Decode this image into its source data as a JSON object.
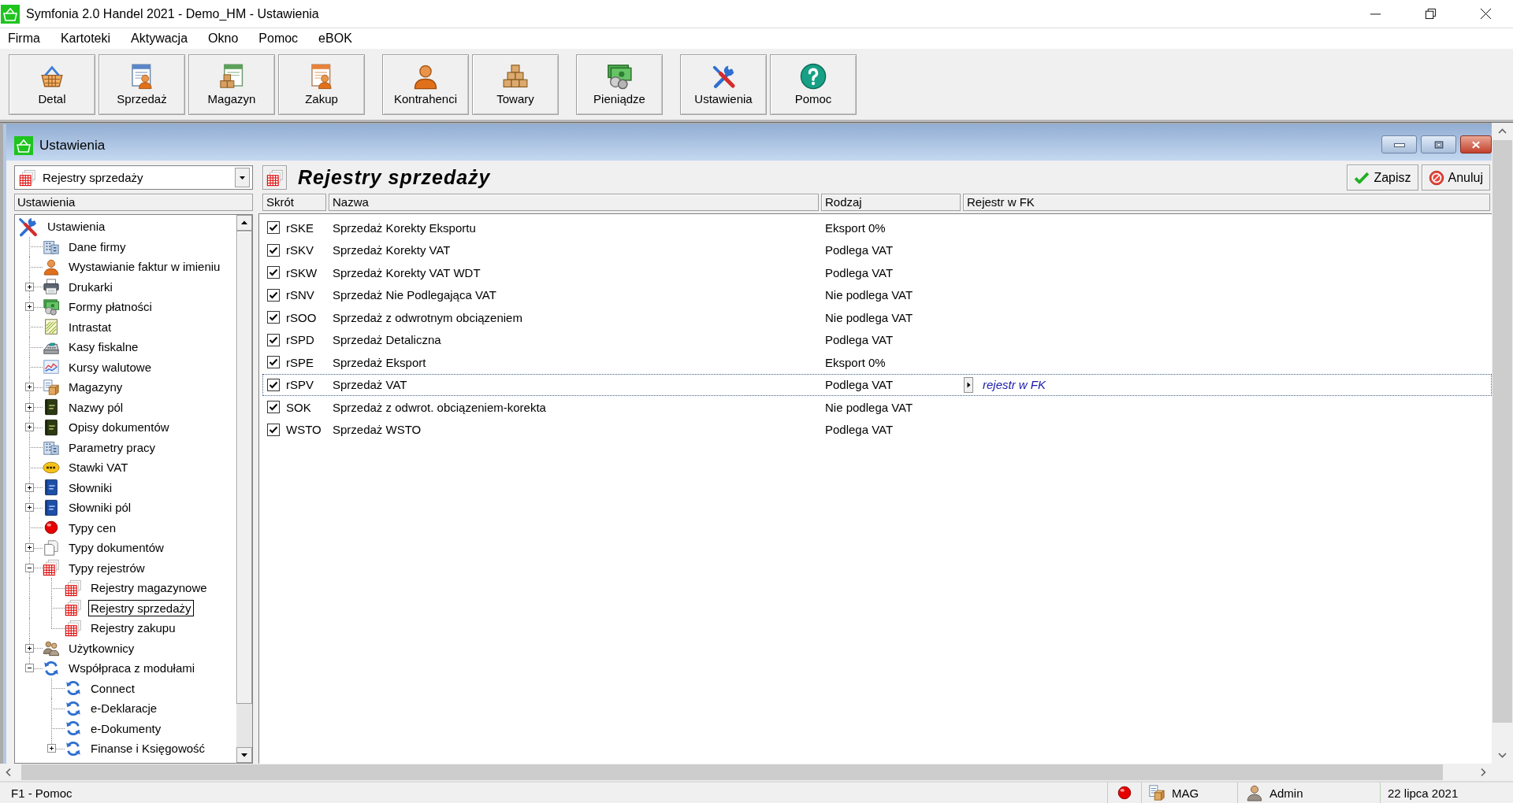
{
  "window": {
    "title": "Symfonia 2.0 Handel 2021 - Demo_HM - Ustawienia"
  },
  "menu": [
    "Firma",
    "Kartoteki",
    "Aktywacja",
    "Okno",
    "Pomoc",
    "eBOK"
  ],
  "toolbar": {
    "groups": [
      {
        "buttons": [
          {
            "label": "Detal",
            "kind": "basket"
          },
          {
            "label": "Sprzedaż",
            "kind": "sales"
          },
          {
            "label": "Magazyn",
            "kind": "warehouse"
          },
          {
            "label": "Zakup",
            "kind": "purchase"
          }
        ]
      },
      {
        "buttons": [
          {
            "label": "Kontrahenci",
            "kind": "person"
          },
          {
            "label": "Towary",
            "kind": "boxes"
          }
        ]
      },
      {
        "buttons": [
          {
            "label": "Pieniądze",
            "kind": "money"
          }
        ]
      },
      {
        "buttons": [
          {
            "label": "Ustawienia",
            "kind": "tools"
          },
          {
            "label": "Pomoc",
            "kind": "help"
          }
        ]
      }
    ]
  },
  "child_window": {
    "title": "Ustawienia"
  },
  "section_picker": {
    "value": "Rejestry sprzedaży"
  },
  "settings_tree": {
    "header": "Ustawienia",
    "nodes": [
      {
        "label": "Ustawienia",
        "kind": "tools",
        "selected": false,
        "children": [
          {
            "label": "Dane firmy",
            "kind": "building",
            "selected": false
          },
          {
            "label": "Wystawianie faktur w imieniu",
            "kind": "person",
            "selected": false
          },
          {
            "label": "Drukarki",
            "kind": "printer",
            "expanded": false,
            "selected": false
          },
          {
            "label": "Formy płatności",
            "kind": "money",
            "expanded": false,
            "selected": false
          },
          {
            "label": "Intrastat",
            "kind": "notepad",
            "selected": false
          },
          {
            "label": "Kasy fiskalne",
            "kind": "register",
            "selected": false
          },
          {
            "label": "Kursy walutowe",
            "kind": "chart",
            "selected": false
          },
          {
            "label": "Magazyny",
            "kind": "store",
            "expanded": false,
            "selected": false
          },
          {
            "label": "Nazwy pól",
            "kind": "book-dark",
            "expanded": false,
            "selected": false
          },
          {
            "label": "Opisy dokumentów",
            "kind": "book-dark",
            "expanded": false,
            "selected": false
          },
          {
            "label": "Parametry pracy",
            "kind": "building",
            "selected": false
          },
          {
            "label": "Stawki VAT",
            "kind": "vat",
            "selected": false
          },
          {
            "label": "Słowniki",
            "kind": "book-blue",
            "expanded": false,
            "selected": false
          },
          {
            "label": "Słowniki pól",
            "kind": "book-blue",
            "expanded": false,
            "selected": false
          },
          {
            "label": "Typy cen",
            "kind": "ball",
            "selected": false
          },
          {
            "label": "Typy dokumentów",
            "kind": "documents",
            "expanded": false,
            "selected": false
          },
          {
            "label": "Typy rejestrów",
            "kind": "grid",
            "expanded": true,
            "selected": false,
            "children": [
              {
                "label": "Rejestry magazynowe",
                "kind": "grid",
                "selected": false
              },
              {
                "label": "Rejestry sprzedaży",
                "kind": "grid",
                "selected": true
              },
              {
                "label": "Rejestry zakupu",
                "kind": "grid",
                "selected": false
              }
            ]
          },
          {
            "label": "Użytkownicy",
            "kind": "users",
            "expanded": false,
            "selected": false
          },
          {
            "label": "Współpraca z modułami",
            "kind": "sync",
            "expanded": true,
            "selected": false,
            "children": [
              {
                "label": "Connect",
                "kind": "sync",
                "selected": false
              },
              {
                "label": "e-Deklaracje",
                "kind": "sync",
                "selected": false
              },
              {
                "label": "e-Dokumenty",
                "kind": "sync",
                "selected": false
              },
              {
                "label": "Finanse i Księgowość",
                "kind": "sync",
                "expanded": false,
                "selected": false
              }
            ]
          }
        ]
      }
    ]
  },
  "panel": {
    "title": "Rejestry sprzedaży",
    "buttons": [
      {
        "label": "Zapisz",
        "kind": "save"
      },
      {
        "label": "Anuluj",
        "kind": "cancel"
      }
    ]
  },
  "table": {
    "columns": [
      "Skrót",
      "Nazwa",
      "Rodzaj",
      "Rejestr w FK"
    ],
    "rows": [
      {
        "checked": true,
        "code": "rSKE",
        "name": "Sprzedaż Korekty Eksportu",
        "type": "Eksport 0%",
        "selected": false
      },
      {
        "checked": true,
        "code": "rSKV",
        "name": "Sprzedaż Korekty VAT",
        "type": "Podlega VAT",
        "selected": false
      },
      {
        "checked": true,
        "code": "rSKW",
        "name": "Sprzedaż Korekty VAT WDT",
        "type": "Podlega VAT",
        "selected": false
      },
      {
        "checked": true,
        "code": "rSNV",
        "name": "Sprzedaż Nie Podlegająca VAT",
        "type": "Nie podlega VAT",
        "selected": false
      },
      {
        "checked": true,
        "code": "rSOO",
        "name": "Sprzedaż z odwrotnym obciązeniem",
        "type": "Nie podlega VAT",
        "selected": false
      },
      {
        "checked": true,
        "code": "rSPD",
        "name": "Sprzedaż Detaliczna",
        "type": "Podlega VAT",
        "selected": false
      },
      {
        "checked": true,
        "code": "rSPE",
        "name": "Sprzedaż Eksport",
        "type": "Eksport 0%",
        "selected": false
      },
      {
        "checked": true,
        "code": "rSPV",
        "name": "Sprzedaż VAT",
        "type": "Podlega VAT",
        "selected": true,
        "fk_register": "rejestr w FK"
      },
      {
        "checked": true,
        "code": "SOK",
        "name": "Sprzedaż z odwrot. obciązeniem-korekta",
        "type": "Nie podlega VAT",
        "selected": false
      },
      {
        "checked": true,
        "code": "WSTO",
        "name": "Sprzedaż WSTO",
        "type": "Podlega VAT",
        "selected": false
      }
    ]
  },
  "status_bar": {
    "help": "F1 - Pomoc",
    "module": "MAG",
    "user": "Admin",
    "date": "22 lipca 2021"
  }
}
